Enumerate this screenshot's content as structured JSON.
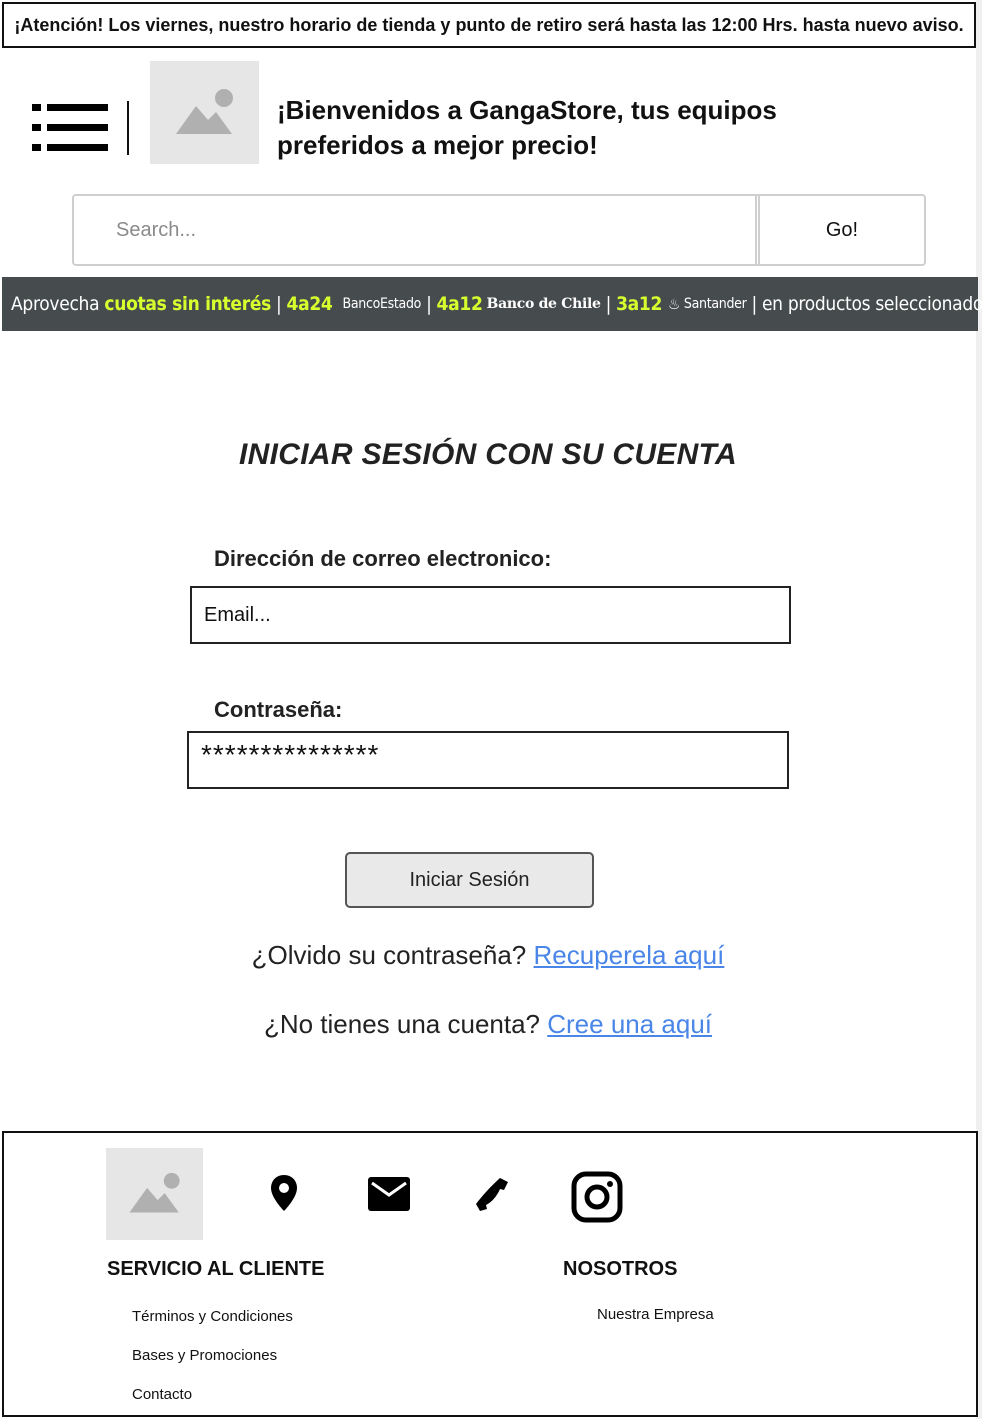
{
  "notice": {
    "text": "¡Atención! Los viernes, nuestro horario de tienda y punto de retiro será hasta las 12:00 Hrs. hasta nuevo aviso."
  },
  "header": {
    "welcome": "¡Bienvenidos a GangaStore, tus equipos preferidos a mejor precio!"
  },
  "search": {
    "placeholder": "Search...",
    "button_label": "Go!"
  },
  "promo": {
    "lead": "Aprovecha",
    "highlight": "cuotas sin interés",
    "offers": [
      {
        "installments": "4a24",
        "bank": "BancoEstado"
      },
      {
        "installments": "4a12",
        "bank": "Banco de Chile"
      },
      {
        "installments": "3a12",
        "bank": "Santander"
      }
    ],
    "tail": "en productos seleccionados"
  },
  "login": {
    "title": "INICIAR SESIÓN CON SU CUENTA",
    "email_label": "Dirección de correo electronico:",
    "email_placeholder": "Email...",
    "password_label": "Contraseña:",
    "password_value": "***************",
    "submit_label": "Iniciar Sesión",
    "forgot_text": "¿Olvido su contraseña?",
    "forgot_link": "Recuperela aquí",
    "signup_text": "¿No tienes una cuenta?",
    "signup_link": "Cree una aquí"
  },
  "footer": {
    "icons": [
      "location-icon",
      "mail-icon",
      "phone-icon",
      "instagram-icon"
    ],
    "customer_service": {
      "title": "SERVICIO AL CLIENTE",
      "links": [
        "Términos y Condiciones",
        "Bases y Promociones",
        "Contacto"
      ]
    },
    "about": {
      "title": "NOSOTROS",
      "links": [
        "Nuestra Empresa"
      ]
    }
  }
}
